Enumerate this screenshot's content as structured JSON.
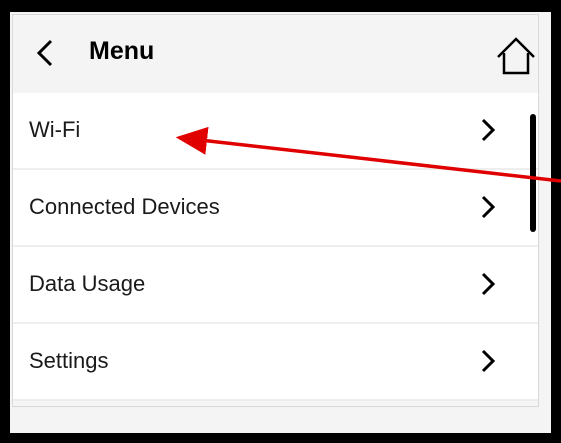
{
  "header": {
    "title": "Menu",
    "back_icon": "chevron-left-icon",
    "home_icon": "home-icon"
  },
  "menu": {
    "items": [
      {
        "label": "Wi-Fi"
      },
      {
        "label": "Connected Devices"
      },
      {
        "label": "Data Usage"
      },
      {
        "label": "Settings"
      }
    ],
    "chevron_icon": "chevron-right-icon"
  },
  "colors": {
    "annotation_arrow": "#e00000",
    "frame": "#000000"
  }
}
